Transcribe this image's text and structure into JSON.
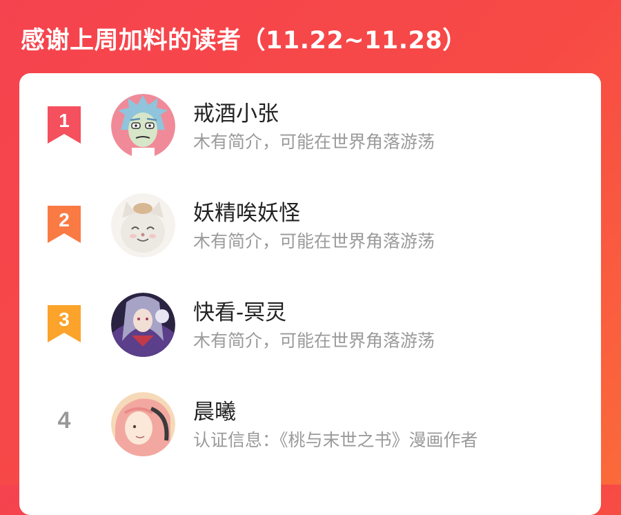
{
  "header": {
    "title": "感谢上周加料的读者（11.22~11.28）"
  },
  "colors": {
    "background_start": "#f5434f",
    "background_end": "#fb6a3a",
    "rank1": "#f4505e",
    "rank2": "#fa7a44",
    "rank3": "#fba32a",
    "rank_plain": "#999999"
  },
  "readers": [
    {
      "rank": "1",
      "name": "戒酒小张",
      "desc": "木有简介，可能在世界角落游荡",
      "avatar": "rick-avatar"
    },
    {
      "rank": "2",
      "name": "妖精唉妖怪",
      "desc": "木有简介，可能在世界角落游荡",
      "avatar": "cat-avatar"
    },
    {
      "rank": "3",
      "name": "快看-冥灵",
      "desc": "木有简介，可能在世界角落游荡",
      "avatar": "anime-character-avatar"
    },
    {
      "rank": "4",
      "name": "晨曦",
      "desc": "认证信息：《桃与末世之书》漫画作者",
      "avatar": "pink-hair-girl-avatar"
    }
  ]
}
